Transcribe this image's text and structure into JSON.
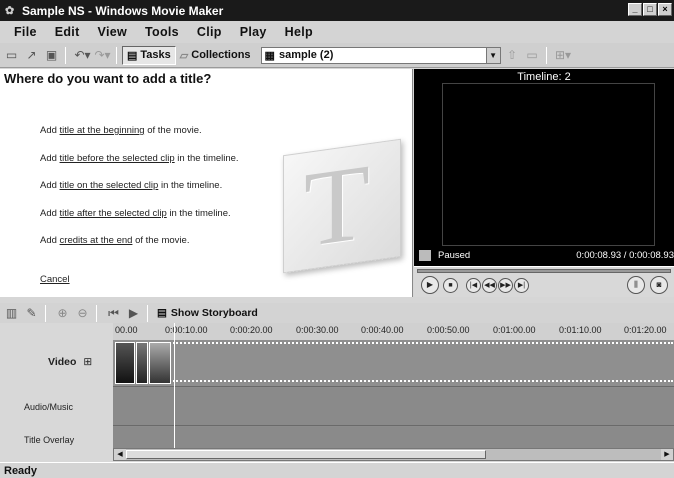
{
  "window": {
    "title": "Sample NS - Windows Movie Maker",
    "controls": [
      "minimize",
      "maximize",
      "close"
    ]
  },
  "menu": [
    "File",
    "Edit",
    "View",
    "Tools",
    "Clip",
    "Play",
    "Help"
  ],
  "toolbar": {
    "tasks_label": "Tasks",
    "collections_label": "Collections",
    "collection_value": "sample (2)"
  },
  "taskpane": {
    "heading": "Where do you want to add a title?",
    "options": [
      {
        "prefix": "Add ",
        "link": "title at the beginning",
        "suffix": " of the movie."
      },
      {
        "prefix": "Add ",
        "link": "title before the selected clip",
        "suffix": " in the timeline."
      },
      {
        "prefix": "Add ",
        "link": "title on the selected clip",
        "suffix": " in the timeline."
      },
      {
        "prefix": "Add ",
        "link": "title after the selected clip",
        "suffix": " in the timeline."
      },
      {
        "prefix": "Add ",
        "link": "credits at the end",
        "suffix": " of the movie."
      }
    ],
    "cancel": "Cancel",
    "watermark_letter": "T"
  },
  "monitor": {
    "title": "Timeline: 2",
    "status": "Paused",
    "time": "0:00:08.93 / 0:00:08.93"
  },
  "timeline": {
    "show_storyboard": "Show Storyboard",
    "ruler": [
      "00.00",
      "0:00:10.00",
      "0:00:20.00",
      "0:00:30.00",
      "0:00:40.00",
      "0:00:50.00",
      "0:01:00.00",
      "0:01:10.00",
      "0:01:20.00"
    ],
    "tracks": {
      "video": "Video",
      "audio": "Audio/Music",
      "title": "Title Overlay"
    }
  },
  "status": "Ready"
}
